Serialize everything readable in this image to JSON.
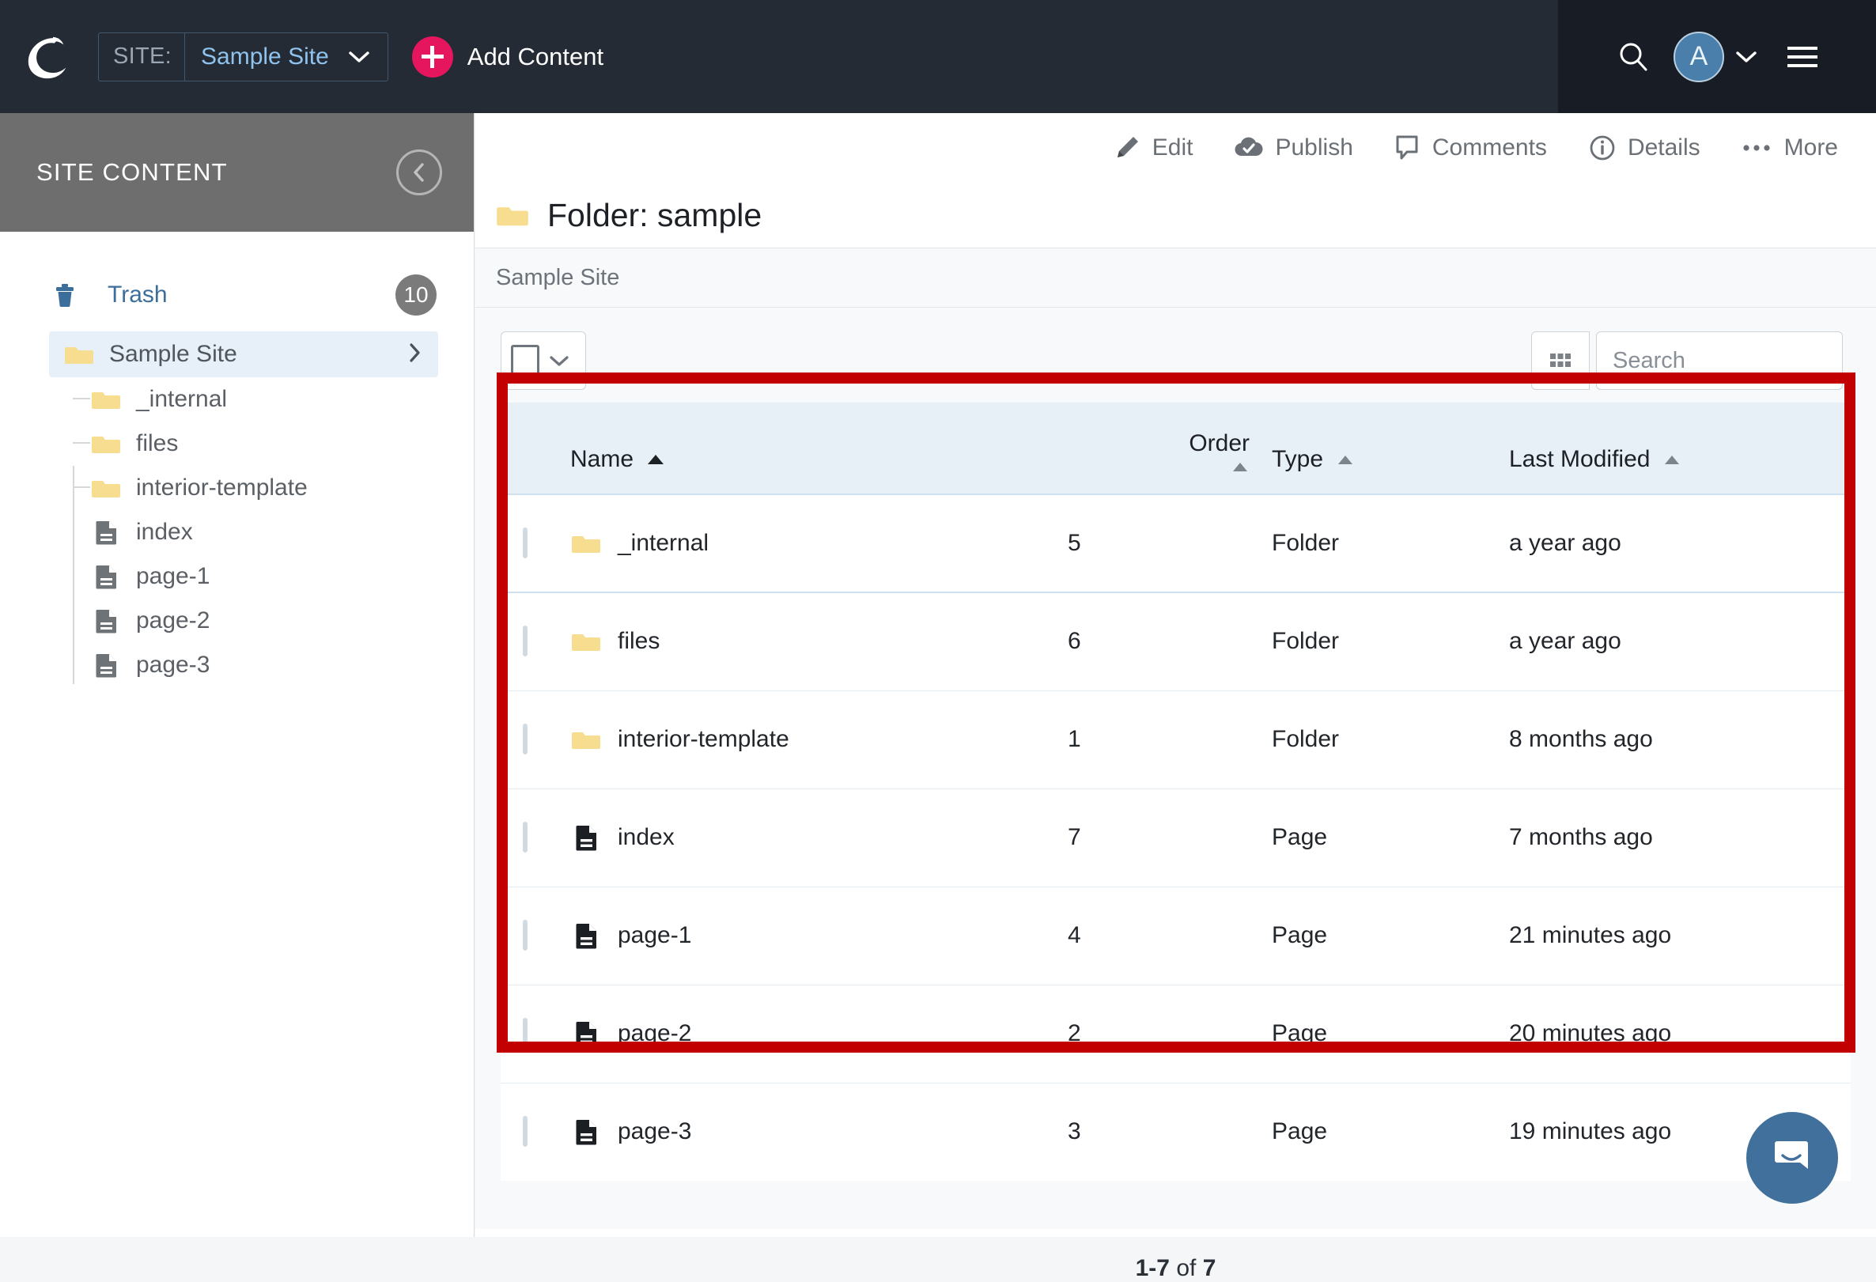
{
  "topbar": {
    "logo_icon": "cascade-logo-icon",
    "site_label": "SITE:",
    "site_value": "Sample Site",
    "add_content_label": "Add Content",
    "search_icon": "search-icon",
    "avatar_initial": "A",
    "avatar_caret_icon": "chevron-down-icon",
    "menu_icon": "hamburger-menu-icon"
  },
  "sidebar": {
    "title": "SITE CONTENT",
    "collapse_icon": "chevron-left-icon",
    "trash": {
      "label": "Trash",
      "count": "10",
      "icon": "trash-icon"
    },
    "items": [
      {
        "label": "Sample Site",
        "icon": "folder-icon",
        "selected": true,
        "chevron": "chevron-right-icon"
      },
      {
        "label": "_internal",
        "icon": "folder-icon",
        "selected": false
      },
      {
        "label": "files",
        "icon": "folder-icon",
        "selected": false
      },
      {
        "label": "interior-template",
        "icon": "folder-icon",
        "selected": false
      },
      {
        "label": "index",
        "icon": "page-icon",
        "selected": false
      },
      {
        "label": "page-1",
        "icon": "page-icon",
        "selected": false
      },
      {
        "label": "page-2",
        "icon": "page-icon",
        "selected": false
      },
      {
        "label": "page-3",
        "icon": "page-icon",
        "selected": false
      }
    ]
  },
  "main": {
    "toolbar": [
      {
        "label": "Edit",
        "icon": "pencil-icon"
      },
      {
        "label": "Publish",
        "icon": "publish-check-icon"
      },
      {
        "label": "Comments",
        "icon": "comment-icon"
      },
      {
        "label": "Details",
        "icon": "info-icon"
      },
      {
        "label": "More",
        "icon": "ellipsis-icon"
      }
    ],
    "page_title": "Folder: sample",
    "page_title_icon": "folder-icon",
    "breadcrumb": "Sample Site",
    "controls": {
      "select_all_icon": "checkbox-icon",
      "select_all_caret_icon": "chevron-down-icon",
      "grid_view_icon": "grid-view-icon",
      "search_placeholder": "Search",
      "search_value": ""
    },
    "table": {
      "columns": [
        {
          "key": "check",
          "label": ""
        },
        {
          "key": "name",
          "label": "Name",
          "sort_icon": "sort-asc-icon",
          "sort_active": true
        },
        {
          "key": "order",
          "label": "Order",
          "sort_icon": "sort-asc-icon",
          "sort_active": false
        },
        {
          "key": "type",
          "label": "Type",
          "sort_icon": "sort-asc-icon",
          "sort_active": false
        },
        {
          "key": "mod",
          "label": "Last Modified",
          "sort_icon": "sort-asc-icon",
          "sort_active": false
        }
      ],
      "rows": [
        {
          "name": "_internal",
          "icon": "folder-icon",
          "order": "5",
          "type": "Folder",
          "modified": "a year ago",
          "focused": true
        },
        {
          "name": "files",
          "icon": "folder-icon",
          "order": "6",
          "type": "Folder",
          "modified": "a year ago",
          "focused": false
        },
        {
          "name": "interior-template",
          "icon": "folder-icon",
          "order": "1",
          "type": "Folder",
          "modified": "8 months ago",
          "focused": false
        },
        {
          "name": "index",
          "icon": "page-icon",
          "order": "7",
          "type": "Page",
          "modified": "7 months ago",
          "focused": false
        },
        {
          "name": "page-1",
          "icon": "page-icon",
          "order": "4",
          "type": "Page",
          "modified": "21 minutes ago",
          "focused": false
        },
        {
          "name": "page-2",
          "icon": "page-icon",
          "order": "2",
          "type": "Page",
          "modified": "20 minutes ago",
          "focused": false
        },
        {
          "name": "page-3",
          "icon": "page-icon",
          "order": "3",
          "type": "Page",
          "modified": "19 minutes ago",
          "focused": false
        }
      ]
    },
    "pagination": {
      "range": "1-7",
      "separator": " of ",
      "total": "7"
    }
  },
  "chat": {
    "icon": "chat-bubble-icon"
  },
  "annotation": {
    "color": "#c20000"
  },
  "colors": {
    "topbar_bg": "#242b35",
    "topbar_right_bg": "#181d25",
    "accent_pink": "#e6165e",
    "sidebar_header_bg": "#6e6e6e",
    "selected_row_bg": "#e7f0f8",
    "table_header_bg": "#e7eff7",
    "folder_yellow": "#f7dd8f",
    "link_blue": "#3c6e9b",
    "annotation_red": "#c20000"
  }
}
